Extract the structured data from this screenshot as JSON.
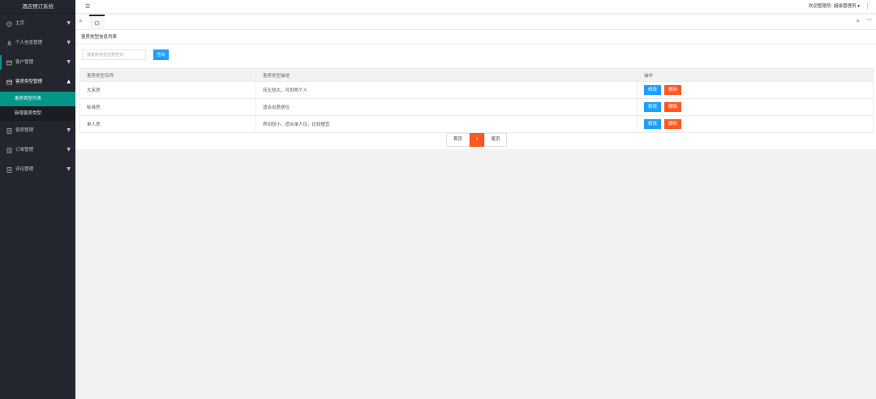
{
  "app": {
    "title": "酒店预订系统"
  },
  "header": {
    "user_label": "欢迎管理员: 超级管理员 ▾",
    "more_icon": "⋮",
    "menu_icon": "☰"
  },
  "tabbar": {
    "left_icon": "«",
    "right_icon": "»",
    "down_icon": "﹀"
  },
  "sidebar": {
    "items": [
      {
        "label": "主页",
        "icon": "home-icon"
      },
      {
        "label": "个人信息管理",
        "icon": "user-icon"
      },
      {
        "label": "客户管理",
        "icon": "table-icon"
      },
      {
        "label": "客房类型管理",
        "icon": "table-icon"
      }
    ],
    "subitems": [
      {
        "label": "客房类型列表"
      },
      {
        "label": "新增客房类型"
      }
    ],
    "items_after": [
      {
        "label": "客房管理",
        "icon": "doc-icon"
      },
      {
        "label": "订单管理",
        "icon": "doc-icon"
      },
      {
        "label": "评论管理",
        "icon": "doc-icon"
      }
    ]
  },
  "content": {
    "title": "客房类型信息列表",
    "search_placeholder": "按客房类型名称查询",
    "search_button": "查询"
  },
  "table": {
    "headers": [
      "客房类型名称",
      "客房类型描述",
      "操作"
    ],
    "rows": [
      {
        "name": "大床房",
        "desc": "床比较大，可供两个人"
      },
      {
        "name": "标准房",
        "desc": "适合出差居住"
      },
      {
        "name": "单人房",
        "desc": "房间较小，适合单人住，比较便宜"
      }
    ],
    "edit_label": "修改",
    "delete_label": "删除"
  },
  "pagination": {
    "first": "首页",
    "current": "1",
    "last": "尾页"
  },
  "colors": {
    "sidebar_bg": "#23262e",
    "accent": "#009688",
    "primary_btn": "#1e9fff",
    "danger_btn": "#ff5722"
  }
}
